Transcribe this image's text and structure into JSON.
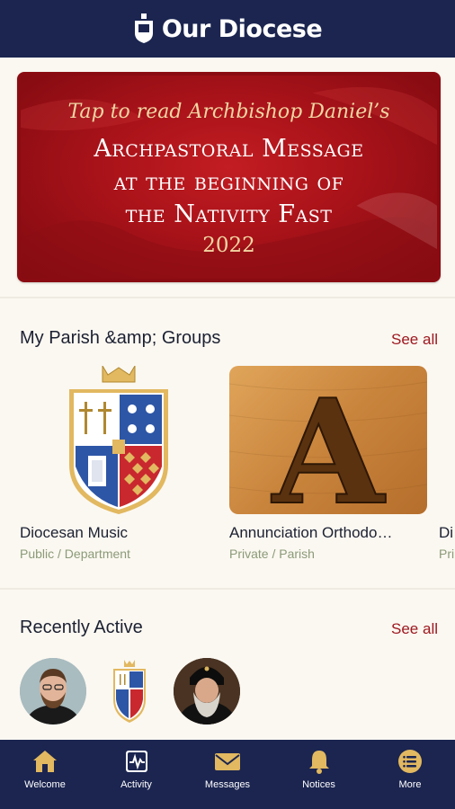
{
  "header": {
    "title": "Our Diocese"
  },
  "banner": {
    "line1": "Tap to read Archbishop Daniel’s",
    "line2": "Archpastoral Message",
    "line3": "at the beginning of",
    "line4": "the Nativity Fast",
    "line5": "2022"
  },
  "groups": {
    "title": "My Parish &amp; Groups",
    "see_all": "See all",
    "items": [
      {
        "name": "Diocesan Music",
        "meta": "Public / Department",
        "icon": "diocese-crest"
      },
      {
        "name": "Annunciation Orthodo…",
        "meta": "Private / Parish",
        "icon": "letter-a-tile",
        "letter": "A"
      },
      {
        "name": "Di",
        "meta": "Pri",
        "icon": "partial-card"
      }
    ]
  },
  "recent": {
    "title": "Recently Active",
    "see_all": "See all",
    "avatars": [
      "priest-avatar",
      "diocese-crest-avatar",
      "archbishop-avatar"
    ]
  },
  "tabs": [
    {
      "label": "Welcome",
      "icon": "home-icon"
    },
    {
      "label": "Activity",
      "icon": "activity-icon"
    },
    {
      "label": "Messages",
      "icon": "envelope-icon"
    },
    {
      "label": "Notices",
      "icon": "bell-icon"
    },
    {
      "label": "More",
      "icon": "menu-list-icon"
    }
  ],
  "colors": {
    "navy": "#1b2550",
    "accent_red": "#9e1820",
    "gold": "#e2b860",
    "background": "#fbf8f1"
  }
}
